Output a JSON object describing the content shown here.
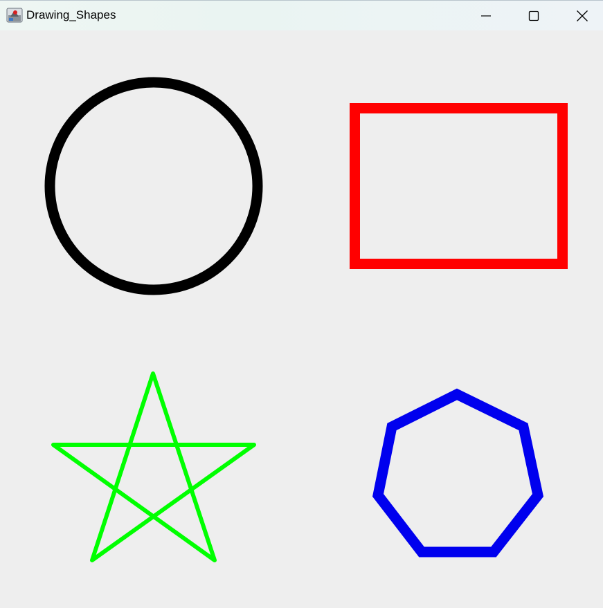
{
  "window": {
    "title": "Drawing_Shapes",
    "controls": {
      "minimize": "minimize-icon",
      "maximize": "maximize-icon",
      "close": "close-icon"
    }
  },
  "canvas": {
    "background": "#eeeeee",
    "shapes": [
      {
        "name": "circle",
        "color": "#000000"
      },
      {
        "name": "rectangle",
        "color": "#ff0000"
      },
      {
        "name": "star",
        "color": "#00ff00"
      },
      {
        "name": "heptagon",
        "color": "#0000ee"
      }
    ]
  }
}
